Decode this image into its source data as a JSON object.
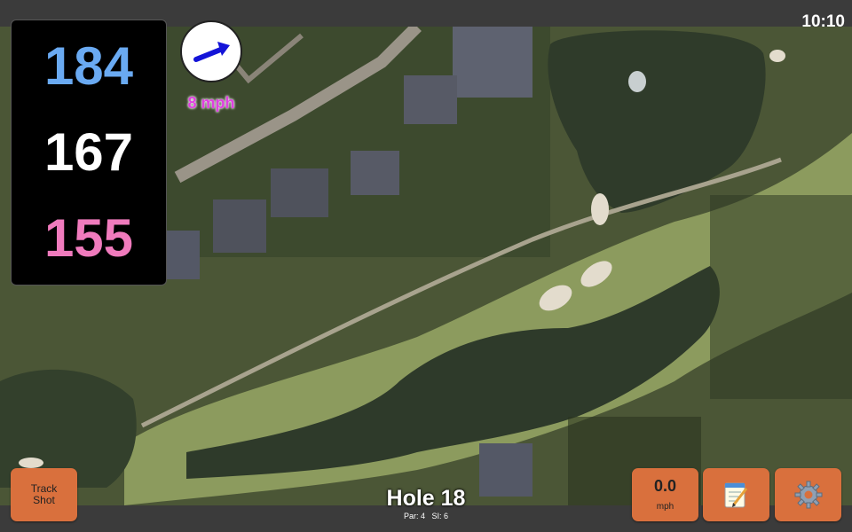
{
  "status": {
    "time": "10:10"
  },
  "distances": {
    "back": "184",
    "middle": "167",
    "front": "155"
  },
  "wind": {
    "speed_label": "8 mph",
    "icon": "wind-arrow-icon"
  },
  "buttons": {
    "track_shot": {
      "label": "Track\nShot"
    },
    "speed": {
      "value": "0.0",
      "unit": "mph"
    },
    "notes": {
      "icon": "notepad-icon"
    },
    "settings": {
      "icon": "gear-icon"
    }
  },
  "hole": {
    "title": "Hole 18",
    "par_label": "Par: 4",
    "si_label": "SI: 6"
  },
  "colors": {
    "back_distance": "#6aaaf2",
    "middle_distance": "#ffffff",
    "front_distance": "#f07bbd",
    "wind_label": "#e040e0",
    "button": "#d9703d"
  }
}
